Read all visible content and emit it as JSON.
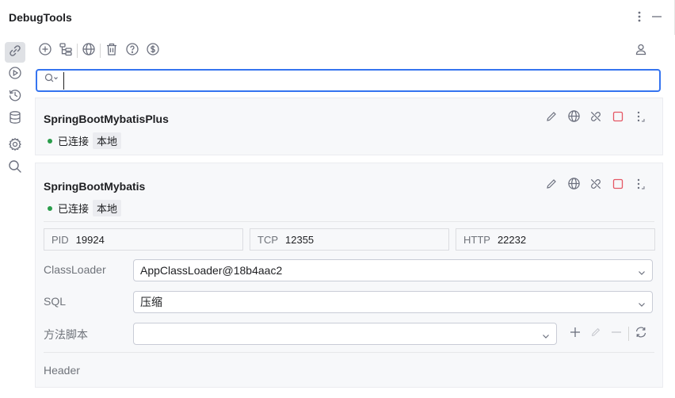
{
  "window": {
    "title": "DebugTools"
  },
  "search": {
    "value": "",
    "placeholder": ""
  },
  "connections": [
    {
      "name": "SpringBootMybatisPlus",
      "status": "已连接",
      "tag": "本地"
    },
    {
      "name": "SpringBootMybatis",
      "status": "已连接",
      "tag": "本地",
      "pid_label": "PID",
      "pid": "19924",
      "tcp_label": "TCP",
      "tcp": "12355",
      "http_label": "HTTP",
      "http": "22232",
      "classloader_label": "ClassLoader",
      "classloader_value": "AppClassLoader@18b4aac2",
      "sql_label": "SQL",
      "sql_value": "压缩",
      "script_label": "方法脚本",
      "script_value": "",
      "header_label": "Header"
    }
  ],
  "colors": {
    "accent": "#3574f0",
    "connected": "#2a9d4b",
    "stop": "#e55765",
    "icon": "#6c707e"
  },
  "icons": {
    "sidebar": [
      "link-icon",
      "run-icon",
      "history-icon",
      "database-icon",
      "settings-icon",
      "search-icon"
    ],
    "toolbar": [
      "add-icon",
      "tree-icon",
      "globe-icon",
      "delete-icon",
      "help-icon",
      "dollar-icon",
      "user-icon"
    ]
  }
}
